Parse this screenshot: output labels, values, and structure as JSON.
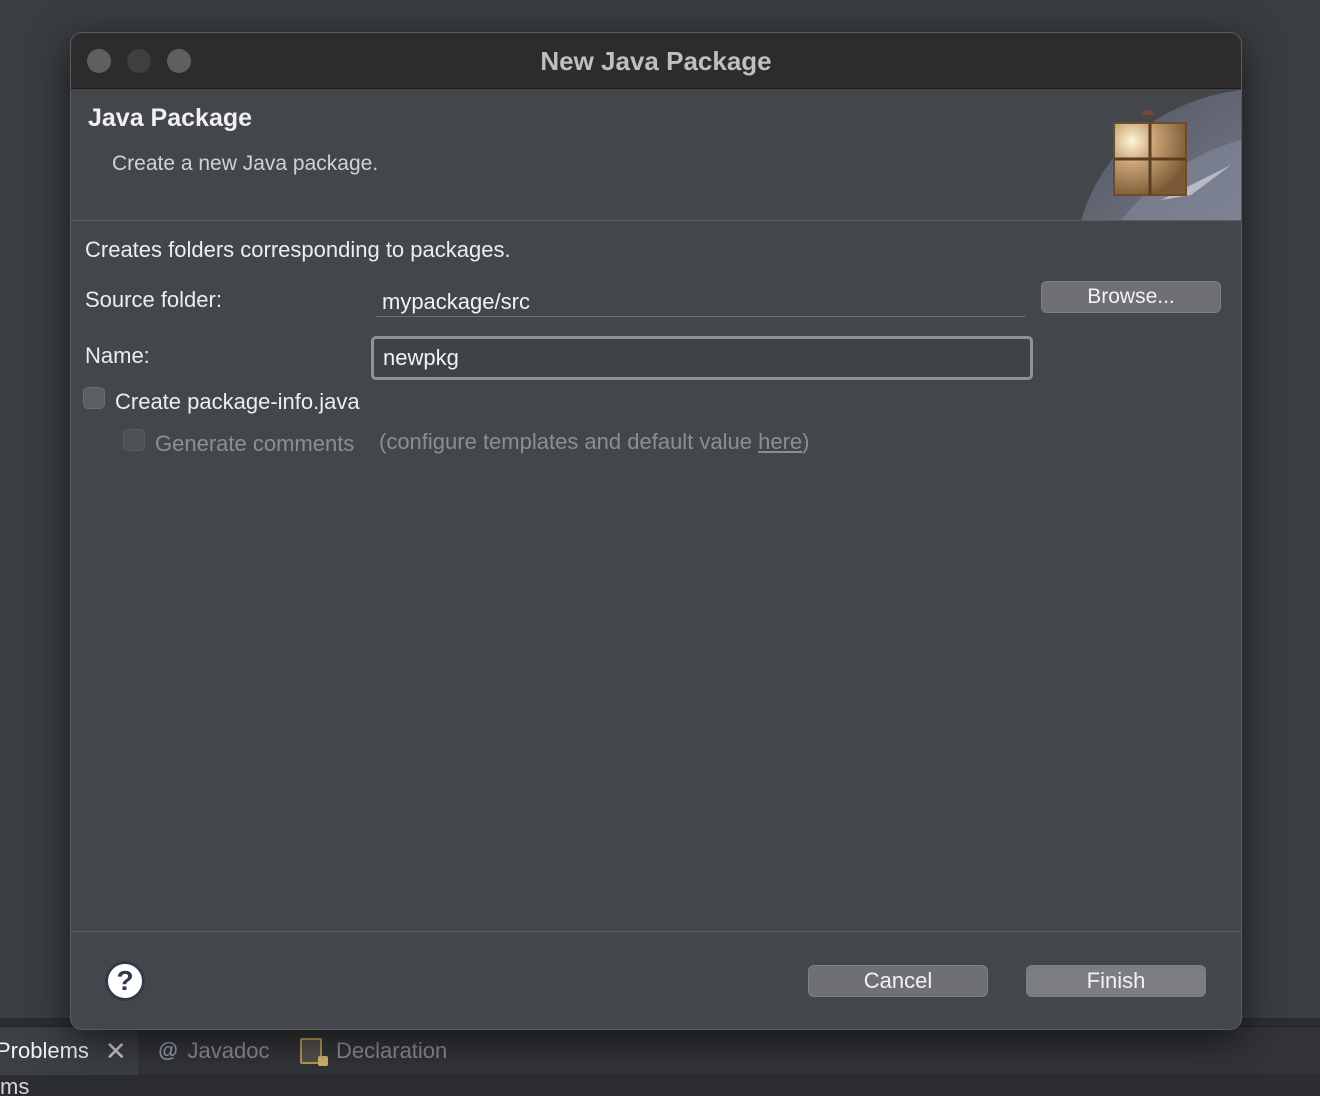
{
  "window": {
    "title": "New Java Package"
  },
  "banner": {
    "title": "Java Package",
    "description": "Create a new Java package.",
    "icon": "package-icon"
  },
  "form": {
    "info": "Creates folders corresponding to packages.",
    "source_folder_label": "Source folder:",
    "source_folder_value": "mypackage/src",
    "browse_label": "Browse...",
    "name_label": "Name:",
    "name_value": "newpkg",
    "create_package_info_label": "Create package-info.java",
    "create_package_info_checked": false,
    "generate_comments_label": "Generate comments",
    "generate_comments_checked": false,
    "hint_prefix": "(configure templates and default value ",
    "hint_link": "here",
    "hint_suffix": ")"
  },
  "footer": {
    "cancel_label": "Cancel",
    "finish_label": "Finish",
    "help_symbol": "?"
  },
  "background": {
    "tabs": [
      {
        "label": "Problems",
        "active": true
      },
      {
        "label": "Javadoc",
        "icon": "@"
      },
      {
        "label": "Declaration"
      }
    ],
    "partial_text": "ms"
  }
}
